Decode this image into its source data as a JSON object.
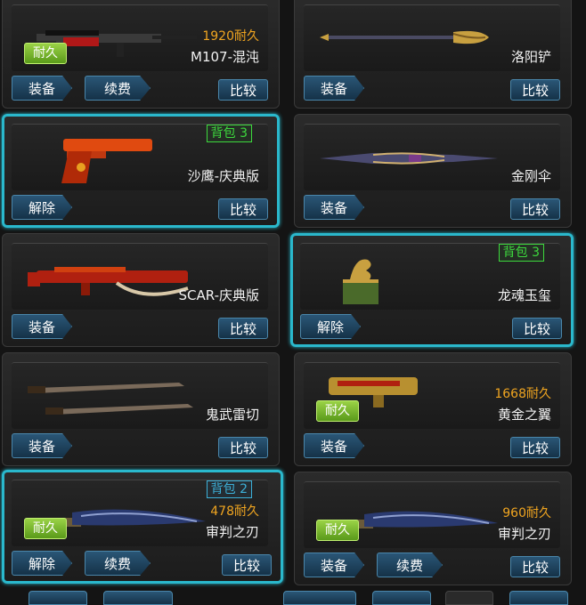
{
  "items": [
    {
      "name": "M107-混沌",
      "durability": "1920耐久",
      "badge": "耐久",
      "left_button": "装备",
      "mid_button": "续费",
      "compare": "比较",
      "selected": false,
      "bag": ""
    },
    {
      "name": "洛阳铲",
      "durability": "",
      "badge": "",
      "left_button": "装备",
      "mid_button": "",
      "compare": "比较",
      "selected": false,
      "bag": ""
    },
    {
      "name": "沙鹰-庆典版",
      "durability": "",
      "badge": "",
      "left_button": "解除",
      "mid_button": "",
      "compare": "比较",
      "selected": true,
      "bag": "背包 3"
    },
    {
      "name": "金刚伞",
      "durability": "",
      "badge": "",
      "left_button": "装备",
      "mid_button": "",
      "compare": "比较",
      "selected": false,
      "bag": ""
    },
    {
      "name": "SCAR-庆典版",
      "durability": "",
      "badge": "",
      "left_button": "装备",
      "mid_button": "",
      "compare": "比较",
      "selected": false,
      "bag": ""
    },
    {
      "name": "龙魂玉玺",
      "durability": "",
      "badge": "",
      "left_button": "解除",
      "mid_button": "",
      "compare": "比较",
      "selected": true,
      "bag": "背包 3"
    },
    {
      "name": "鬼武雷切",
      "durability": "",
      "badge": "",
      "left_button": "装备",
      "mid_button": "",
      "compare": "比较",
      "selected": false,
      "bag": ""
    },
    {
      "name": "黄金之翼",
      "durability": "1668耐久",
      "badge": "耐久",
      "left_button": "装备",
      "mid_button": "",
      "compare": "比较",
      "selected": false,
      "bag": ""
    },
    {
      "name": "审判之刃",
      "durability": "478耐久",
      "badge": "耐久",
      "left_button": "解除",
      "mid_button": "续费",
      "compare": "比较",
      "selected": true,
      "bag": "背包 2"
    },
    {
      "name": "审判之刃",
      "durability": "960耐久",
      "badge": "耐久",
      "left_button": "装备",
      "mid_button": "续费",
      "compare": "比较",
      "selected": false,
      "bag": ""
    }
  ],
  "colors": {
    "accent": "#2ab8cc",
    "durability": "#f0a520",
    "bag_green": "#3dd93d",
    "bag_blue": "#3cb0d8"
  }
}
